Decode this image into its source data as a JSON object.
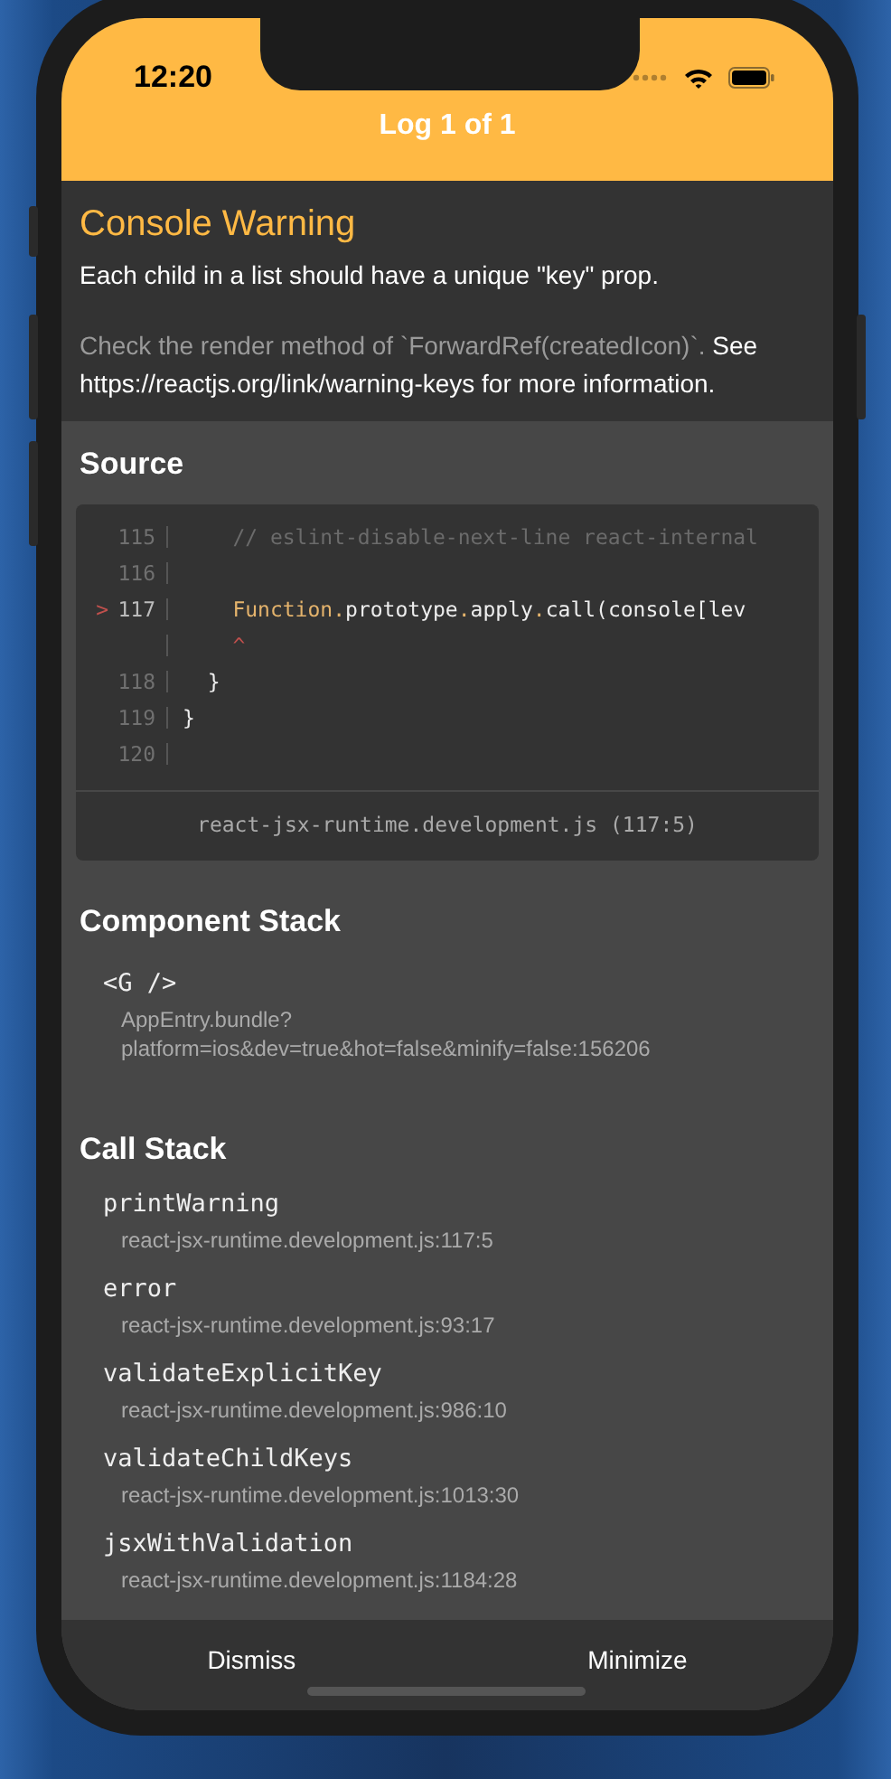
{
  "status_bar": {
    "time": "12:20"
  },
  "header": {
    "title": "Log 1 of 1"
  },
  "warning": {
    "title": "Console Warning",
    "message": "Each child in a list should have a unique \"key\" prop.",
    "detail": [
      {
        "text": "Check the render method of `ForwardRef(createdIcon)`.",
        "dimmed": true
      },
      {
        "text": " See https://reactjs.org/link/warning-keys for more information.",
        "dimmed": false
      }
    ]
  },
  "source": {
    "heading": "Source",
    "lines": [
      {
        "number": "115",
        "current": false,
        "tokens": [
          {
            "text": "    // eslint-disable-next-line react-internal",
            "kind": "comment"
          }
        ]
      },
      {
        "number": "116",
        "current": false
      },
      {
        "number": "117",
        "current": true,
        "pointer": ">",
        "tokens": [
          {
            "text": "    Function",
            "kind": "keyword"
          },
          {
            "text": ".",
            "kind": "keyword"
          },
          {
            "text": "prototype",
            "kind": "plain"
          },
          {
            "text": ".",
            "kind": "keyword"
          },
          {
            "text": "apply",
            "kind": "plain"
          },
          {
            "text": ".",
            "kind": "keyword"
          },
          {
            "text": "call(console[lev",
            "kind": "plain"
          }
        ]
      },
      {
        "tokens": [
          {
            "text": "    ^",
            "kind": "marker"
          }
        ]
      },
      {
        "number": "118",
        "current": false,
        "tokens": [
          {
            "text": "  }",
            "kind": "plain"
          }
        ]
      },
      {
        "number": "119",
        "current": false,
        "tokens": [
          {
            "text": "}",
            "kind": "plain"
          }
        ]
      },
      {
        "number": "120",
        "current": false
      }
    ],
    "file": "react-jsx-runtime.development.js (117:5)"
  },
  "component_stack": {
    "heading": "Component Stack",
    "items": [
      {
        "name": "<G />",
        "location": "AppEntry.bundle?platform=ios&dev=true&hot=false&minify=false:156206"
      }
    ]
  },
  "call_stack": {
    "heading": "Call Stack",
    "frames": [
      {
        "name": "printWarning",
        "location": "react-jsx-runtime.development.js:117:5"
      },
      {
        "name": "error",
        "location": "react-jsx-runtime.development.js:93:17"
      },
      {
        "name": "validateExplicitKey",
        "location": "react-jsx-runtime.development.js:986:10"
      },
      {
        "name": "validateChildKeys",
        "location": "react-jsx-runtime.development.js:1013:30"
      },
      {
        "name": "jsxWithValidation",
        "location": "react-jsx-runtime.development.js:1184:28"
      }
    ]
  },
  "footer": {
    "buttons": [
      "Dismiss",
      "Minimize"
    ]
  }
}
